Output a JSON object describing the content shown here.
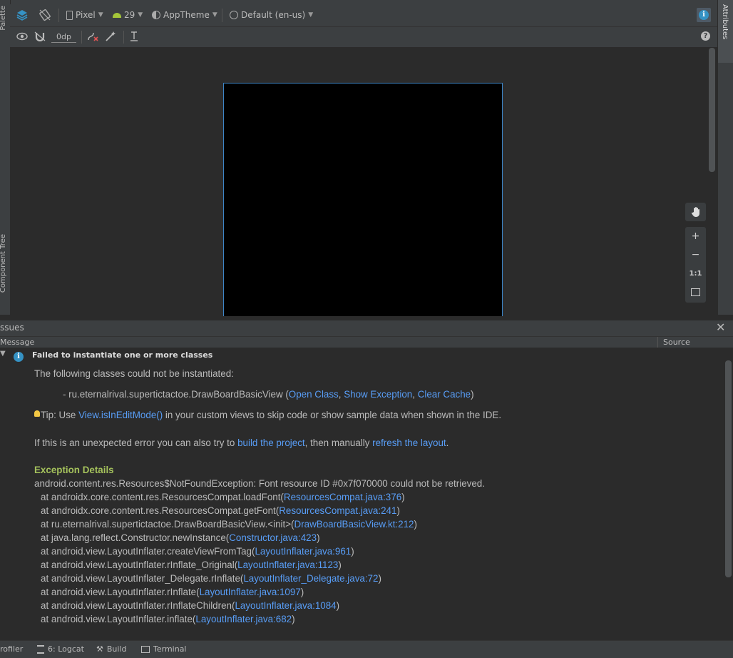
{
  "left_strip": {
    "palette": "Palette",
    "component_tree": "Component Tree"
  },
  "right_strip": {
    "attributes": "Attributes"
  },
  "toolbar1": {
    "device": "Pixel",
    "api": "29",
    "theme": "AppTheme",
    "locale": "Default (en-us)"
  },
  "toolbar2": {
    "margin": "0dp"
  },
  "zoom": {
    "plus": "+",
    "minus": "−",
    "one_to_one": "1:1"
  },
  "issues": {
    "title": "ssues",
    "col_message": "Message",
    "col_source": "Source",
    "error_title": "Failed to instantiate one or more classes",
    "line1": "The following classes could not be instantiated:",
    "line2_prefix": "- ru.eternalrival.supertictactoe.DrawBoardBasicView (",
    "line2_open_class": "Open Class",
    "line2_comma1": ", ",
    "line2_show_exception": "Show Exception",
    "line2_comma2": ", ",
    "line2_clear_cache": "Clear Cache",
    "line2_suffix": ")",
    "tip_prefix": "Tip: Use ",
    "tip_link": "View.isInEditMode()",
    "tip_suffix": " in your custom views to skip code or show sample data when shown in the IDE.",
    "err_prefix": "If this is an unexpected error you can also try to ",
    "err_link1": "build the project",
    "err_mid": ", then manually ",
    "err_link2": "refresh the layout",
    "err_suffix": ".",
    "exception_title": "Exception Details",
    "exception_line": "android.content.res.Resources$NotFoundException: Font resource ID #0x7f070000 could not be retrieved.",
    "stack": [
      {
        "text": "at androidx.core.content.res.ResourcesCompat.loadFont(",
        "link": "ResourcesCompat.java:376",
        "end": ")"
      },
      {
        "text": "at androidx.core.content.res.ResourcesCompat.getFont(",
        "link": "ResourcesCompat.java:241",
        "end": ")"
      },
      {
        "text": "at ru.eternalrival.supertictactoe.DrawBoardBasicView.<init>(",
        "link": "DrawBoardBasicView.kt:212",
        "end": ")"
      },
      {
        "text": "at java.lang.reflect.Constructor.newInstance(",
        "link": "Constructor.java:423",
        "end": ")"
      },
      {
        "text": "at android.view.LayoutInflater.createViewFromTag(",
        "link": "LayoutInflater.java:961",
        "end": ")"
      },
      {
        "text": "at android.view.LayoutInflater.rInflate_Original(",
        "link": "LayoutInflater.java:1123",
        "end": ")"
      },
      {
        "text": "at android.view.LayoutInflater_Delegate.rInflate(",
        "link": "LayoutInflater_Delegate.java:72",
        "end": ")"
      },
      {
        "text": "at android.view.LayoutInflater.rInflate(",
        "link": "LayoutInflater.java:1097",
        "end": ")"
      },
      {
        "text": "at android.view.LayoutInflater.rInflateChildren(",
        "link": "LayoutInflater.java:1084",
        "end": ")"
      },
      {
        "text": "at android.view.LayoutInflater.inflate(",
        "link": "LayoutInflater.java:682",
        "end": ")"
      }
    ]
  },
  "bottom_bar": {
    "profiler": "rofiler",
    "logcat": "6: Logcat",
    "build": "Build",
    "terminal": "Terminal"
  },
  "colors": {
    "accent": "#589df6",
    "green": "#a5c25c",
    "info": "#3592c4"
  }
}
